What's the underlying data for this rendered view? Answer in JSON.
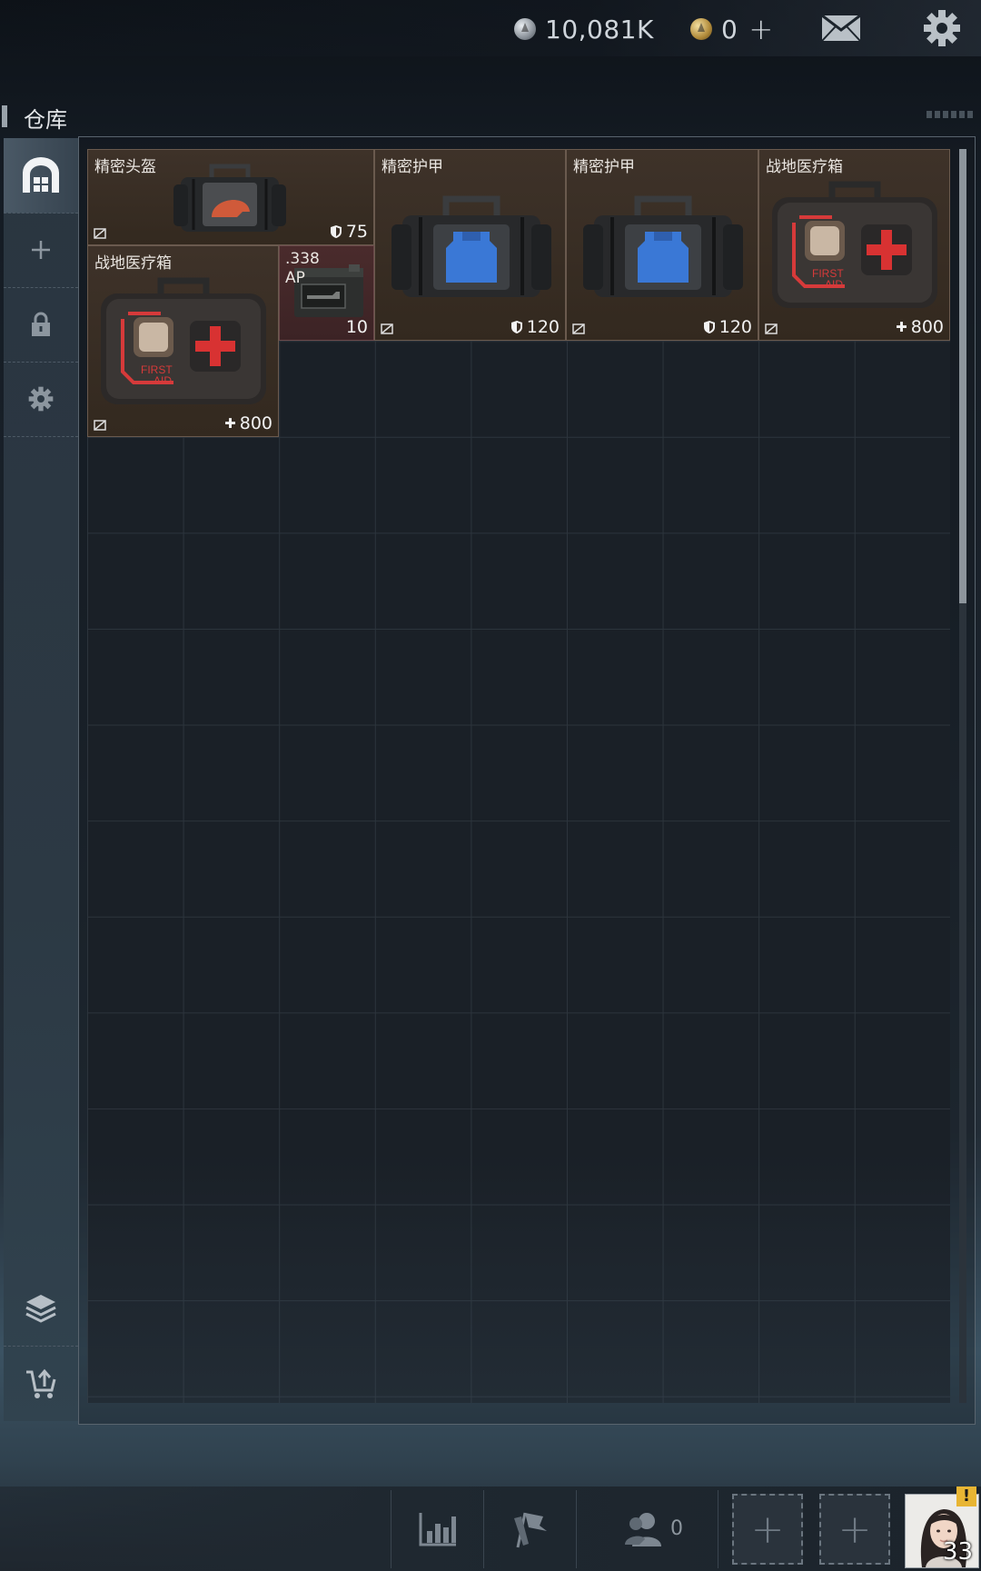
{
  "topbar": {
    "silver_amount": "10,081K",
    "gold_amount": "0",
    "gold_add_symbol": "+",
    "icons": [
      "silver-coin-icon",
      "gold-coin-icon",
      "mail-icon",
      "gear-icon"
    ]
  },
  "page": {
    "title": "仓库"
  },
  "sidebar": {
    "items": [
      {
        "icon": "warehouse-icon",
        "active": true
      },
      {
        "icon": "plus-icon"
      },
      {
        "icon": "lock-icon"
      },
      {
        "icon": "gear-icon"
      },
      {
        "icon": "layers-icon"
      },
      {
        "icon": "cart-upload-icon"
      }
    ]
  },
  "inventory": {
    "items": [
      {
        "name": "精密头盔",
        "stat_icon": "shield-icon",
        "value": "75"
      },
      {
        "name": "精密护甲",
        "stat_icon": "shield-icon",
        "value": "120"
      },
      {
        "name": "精密护甲",
        "stat_icon": "shield-icon",
        "value": "120"
      },
      {
        "name": "战地医疗箱",
        "stat_icon": "health-icon",
        "value": "800"
      },
      {
        "name": "战地医疗箱",
        "stat_icon": "health-icon",
        "value": "800"
      },
      {
        "caliber_line1": ".338",
        "caliber_line2": "AP",
        "value": "10"
      }
    ],
    "medkit_label_1": "FIRST",
    "medkit_label_2": "AID",
    "health_symbol": "✚"
  },
  "bottombar": {
    "friend_count": "0",
    "slot_symbol": "+",
    "player_level": "33",
    "alert_symbol": "!"
  },
  "colors": {
    "item_bg": "#3a2e25",
    "ammo_bg": "#4a2b2c",
    "grid_bg": "#1a2027",
    "alert": "#e8b533"
  }
}
